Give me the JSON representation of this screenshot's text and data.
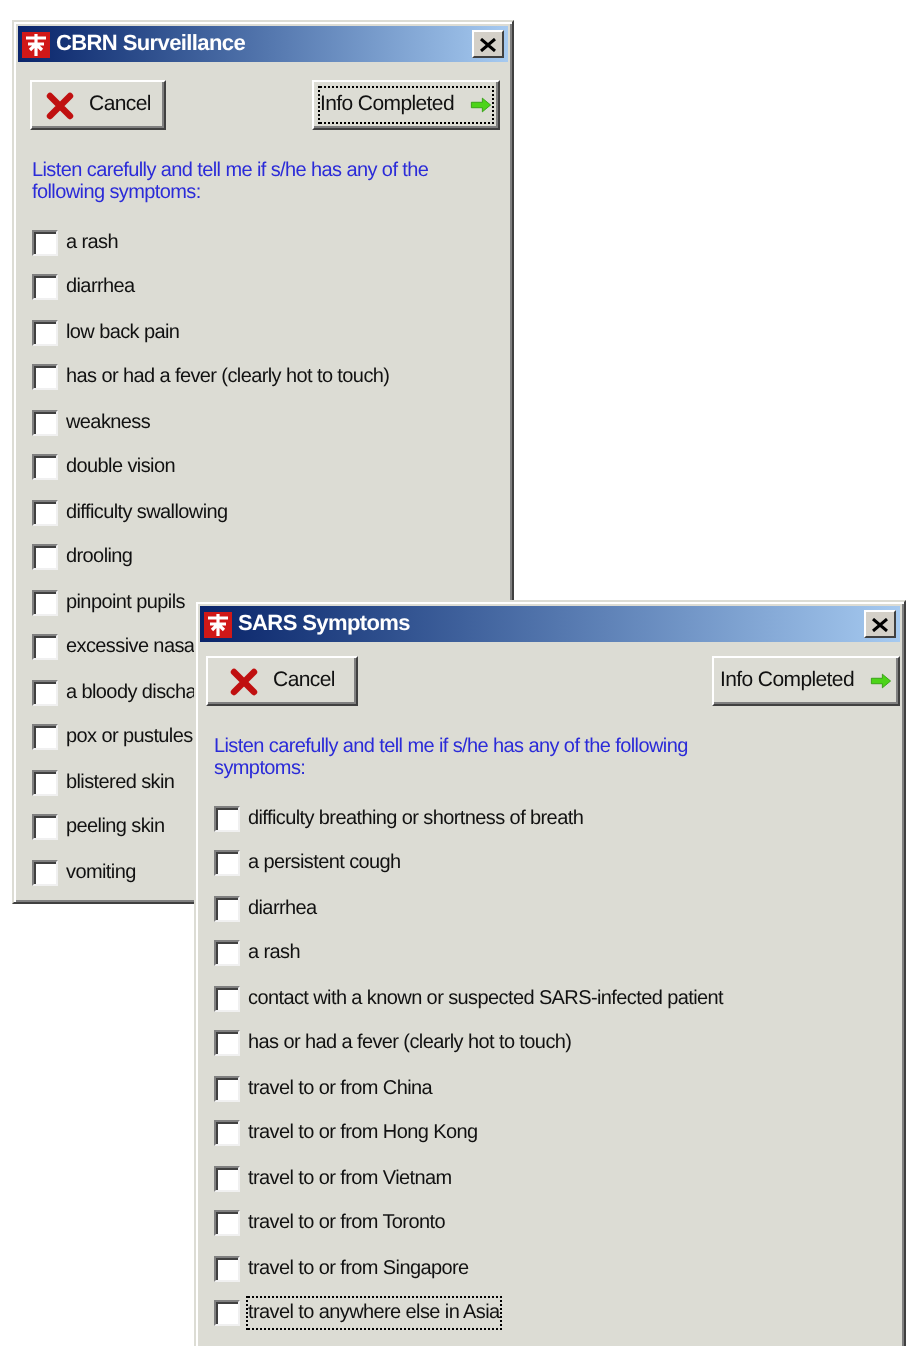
{
  "windows": [
    {
      "title": "CBRN Surveillance",
      "cancel": {
        "label": "Cancel",
        "focused": false
      },
      "done": {
        "label": "Info Completed",
        "focused": true
      },
      "instruction": "Listen carefully and tell me if s/he has any of the following symptoms:",
      "symptoms": [
        {
          "label": "a rash",
          "checked": false,
          "focused": false
        },
        {
          "label": "diarrhea",
          "checked": false,
          "focused": false
        },
        {
          "label": "low back pain",
          "checked": false,
          "focused": false
        },
        {
          "label": "has or had a fever (clearly hot to touch)",
          "checked": false,
          "focused": false
        },
        {
          "label": "weakness",
          "checked": false,
          "focused": false
        },
        {
          "label": "double vision",
          "checked": false,
          "focused": false
        },
        {
          "label": "difficulty swallowing",
          "checked": false,
          "focused": false
        },
        {
          "label": "drooling",
          "checked": false,
          "focused": false
        },
        {
          "label": "pinpoint pupils",
          "checked": false,
          "focused": false
        },
        {
          "label": "excessive nasa",
          "checked": false,
          "focused": false
        },
        {
          "label": "a bloody discha",
          "checked": false,
          "focused": false
        },
        {
          "label": "pox or pustules",
          "checked": false,
          "focused": false
        },
        {
          "label": "blistered skin",
          "checked": false,
          "focused": false
        },
        {
          "label": "peeling skin",
          "checked": false,
          "focused": false
        },
        {
          "label": "vomiting",
          "checked": false,
          "focused": false
        }
      ]
    },
    {
      "title": "SARS Symptoms",
      "cancel": {
        "label": "Cancel",
        "focused": false
      },
      "done": {
        "label": "Info Completed",
        "focused": false
      },
      "instruction": "Listen carefully and tell me if s/he has any of the following symptoms:",
      "symptoms": [
        {
          "label": "difficulty breathing or shortness of breath",
          "checked": false,
          "focused": false
        },
        {
          "label": "a persistent cough",
          "checked": false,
          "focused": false
        },
        {
          "label": "diarrhea",
          "checked": false,
          "focused": false
        },
        {
          "label": "a rash",
          "checked": false,
          "focused": false
        },
        {
          "label": "contact with a known or suspected SARS-infected patient",
          "checked": false,
          "focused": false
        },
        {
          "label": "has or had a fever (clearly hot to touch)",
          "checked": false,
          "focused": false
        },
        {
          "label": "travel to or from China",
          "checked": false,
          "focused": false
        },
        {
          "label": "travel to or from Hong Kong",
          "checked": false,
          "focused": false
        },
        {
          "label": "travel to or from Vietnam",
          "checked": false,
          "focused": false
        },
        {
          "label": "travel to or from Toronto",
          "checked": false,
          "focused": false
        },
        {
          "label": "travel to or from Singapore",
          "checked": false,
          "focused": false
        },
        {
          "label": "travel to anywhere else in Asia",
          "checked": false,
          "focused": true
        }
      ]
    }
  ]
}
